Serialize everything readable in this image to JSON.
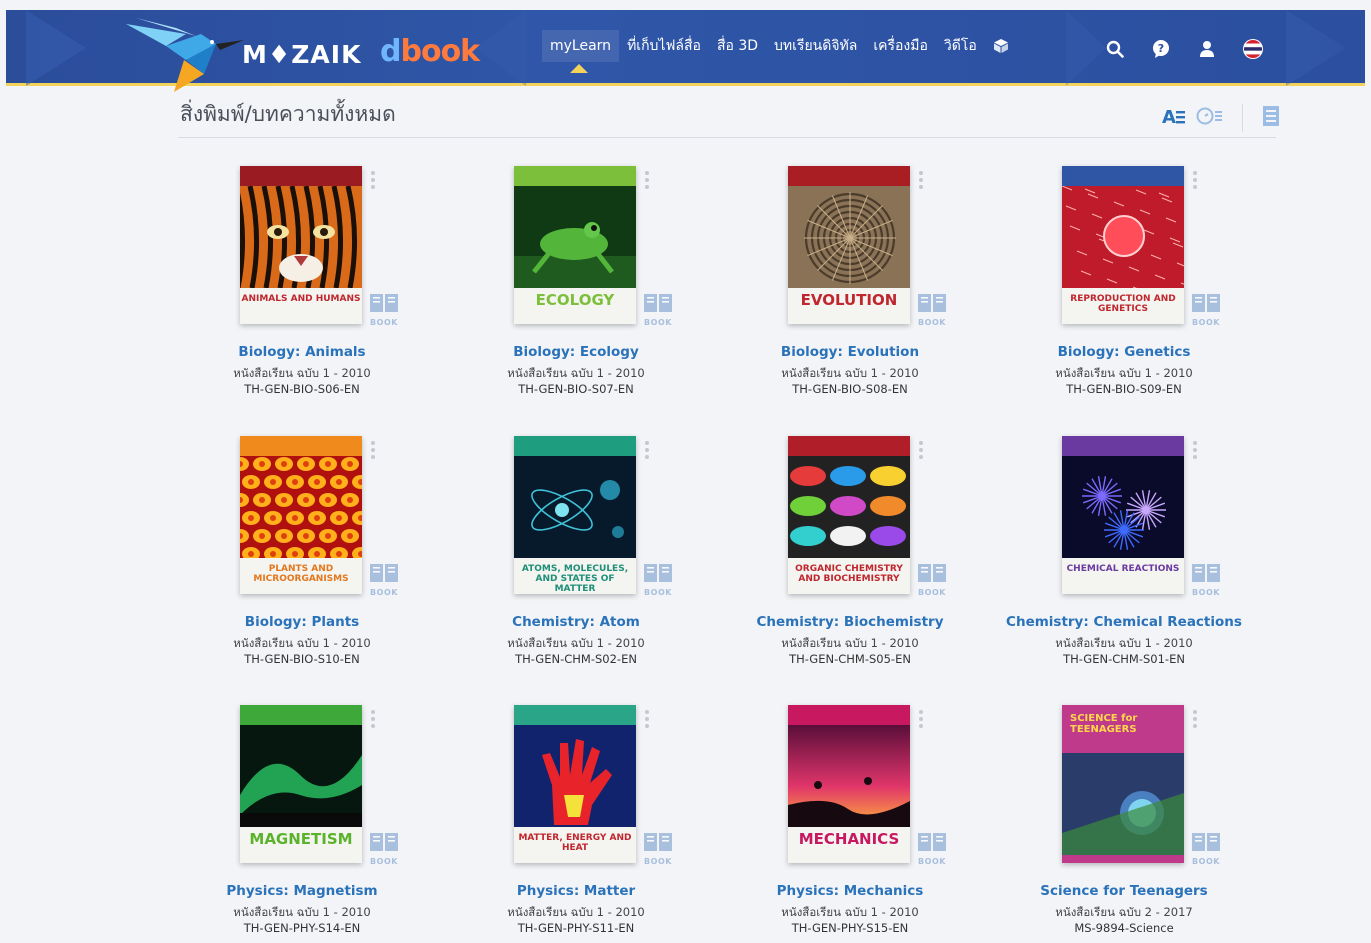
{
  "app": {
    "brand_main": "M♦ZAIK",
    "brand_d": "d",
    "brand_book": "book"
  },
  "nav": {
    "items": [
      {
        "label": "myLearn",
        "active": true
      },
      {
        "label": "ที่เก็บไฟล์สื่อ"
      },
      {
        "label": "สื่อ 3D"
      },
      {
        "label": "บทเรียนดิจิทัล"
      },
      {
        "label": "เครื่องมือ"
      },
      {
        "label": "วิดีโอ"
      }
    ],
    "icons": [
      "cube-icon",
      "search-icon",
      "help-icon",
      "user-icon",
      "thai-flag-icon"
    ]
  },
  "page": {
    "title": "สิ่งพิมพ์/บทความทั้งหมด"
  },
  "book_label": "BOOK",
  "colors": {
    "nav_bg": "#2c4f9f",
    "accent_yellow": "#f2d25a",
    "title_blue": "#2a72b9"
  },
  "books": [
    {
      "title": "Biology: Animals",
      "sub": "หนังสือเรียน ฉบับ 1 - 2010",
      "code": "TH-GEN-BIO-S06-EN",
      "cover_text": "ANIMALS AND HUMANS",
      "cover_big": false,
      "band": "#9b1b22",
      "text_color": "#c0262d",
      "art": "tiger"
    },
    {
      "title": "Biology: Ecology",
      "sub": "หนังสือเรียน ฉบับ 1 - 2010",
      "code": "TH-GEN-BIO-S07-EN",
      "cover_text": "ECOLOGY",
      "cover_big": true,
      "band": "#7bbf3a",
      "text_color": "#7cbf3a",
      "art": "frog"
    },
    {
      "title": "Biology: Evolution",
      "sub": "หนังสือเรียน ฉบับ 1 - 2010",
      "code": "TH-GEN-BIO-S08-EN",
      "cover_text": "EVOLUTION",
      "cover_big": true,
      "band": "#a81e22",
      "text_color": "#c0262d",
      "art": "fossil"
    },
    {
      "title": "Biology: Genetics",
      "sub": "หนังสือเรียน ฉบับ 1 - 2010",
      "code": "TH-GEN-BIO-S09-EN",
      "cover_text": "REPRODUCTION AND GENETICS",
      "cover_big": false,
      "band": "#2f55a5",
      "text_color": "#c0262d",
      "art": "cell"
    },
    {
      "title": "Biology: Plants",
      "sub": "หนังสือเรียน ฉบับ 1 - 2010",
      "code": "TH-GEN-BIO-S10-EN",
      "cover_text": "PLANTS AND MICROORGANISMS",
      "cover_big": false,
      "band": "#f08a1c",
      "text_color": "#e5771c",
      "art": "plantcells"
    },
    {
      "title": "Chemistry: Atom",
      "sub": "หนังสือเรียน ฉบับ 1 - 2010",
      "code": "TH-GEN-CHM-S02-EN",
      "cover_text": "ATOMS, MOLECULES, AND STATES OF MATTER",
      "cover_big": false,
      "band": "#1f9e7f",
      "text_color": "#1f8f78",
      "art": "atom"
    },
    {
      "title": "Chemistry: Biochemistry",
      "sub": "หนังสือเรียน ฉบับ 1 - 2010",
      "code": "TH-GEN-CHM-S05-EN",
      "cover_text": "ORGANIC CHEMISTRY AND BIOCHEMISTRY",
      "cover_big": false,
      "band": "#b01e2a",
      "text_color": "#c0262d",
      "art": "paint"
    },
    {
      "title": "Chemistry: Chemical Reactions",
      "sub": "หนังสือเรียน ฉบับ 1 - 2010",
      "code": "TH-GEN-CHM-S01-EN",
      "cover_text": "CHEMICAL REACTIONS",
      "cover_big": false,
      "band": "#6a3aa0",
      "text_color": "#6a3aa0",
      "art": "fireworks"
    },
    {
      "title": "Physics: Magnetism",
      "sub": "หนังสือเรียน ฉบับ 1 - 2010",
      "code": "TH-GEN-PHY-S14-EN",
      "cover_text": "MAGNETISM",
      "cover_big": true,
      "band": "#3fa83a",
      "text_color": "#5ab32a",
      "art": "aurora"
    },
    {
      "title": "Physics: Matter",
      "sub": "หนังสือเรียน ฉบับ 1 - 2010",
      "code": "TH-GEN-PHY-S11-EN",
      "cover_text": "MATTER, ENERGY AND HEAT",
      "cover_big": false,
      "band": "#2aa588",
      "text_color": "#c0262d",
      "art": "hand"
    },
    {
      "title": "Physics: Mechanics",
      "sub": "หนังสือเรียน ฉบับ 1 - 2010",
      "code": "TH-GEN-PHY-S15-EN",
      "cover_text": "MECHANICS",
      "cover_big": true,
      "band": "#c8185f",
      "text_color": "#c8185f",
      "art": "sunset"
    },
    {
      "title": "Science for Teenagers",
      "sub": "หนังสือเรียน ฉบับ 2 - 2017",
      "code": "MS-9894-Science",
      "cover_text": "SCIENCE for TEENAGERS",
      "cover_big": false,
      "band": "#c03a8c",
      "text_color": "#ffd84a",
      "art": "teen"
    }
  ]
}
